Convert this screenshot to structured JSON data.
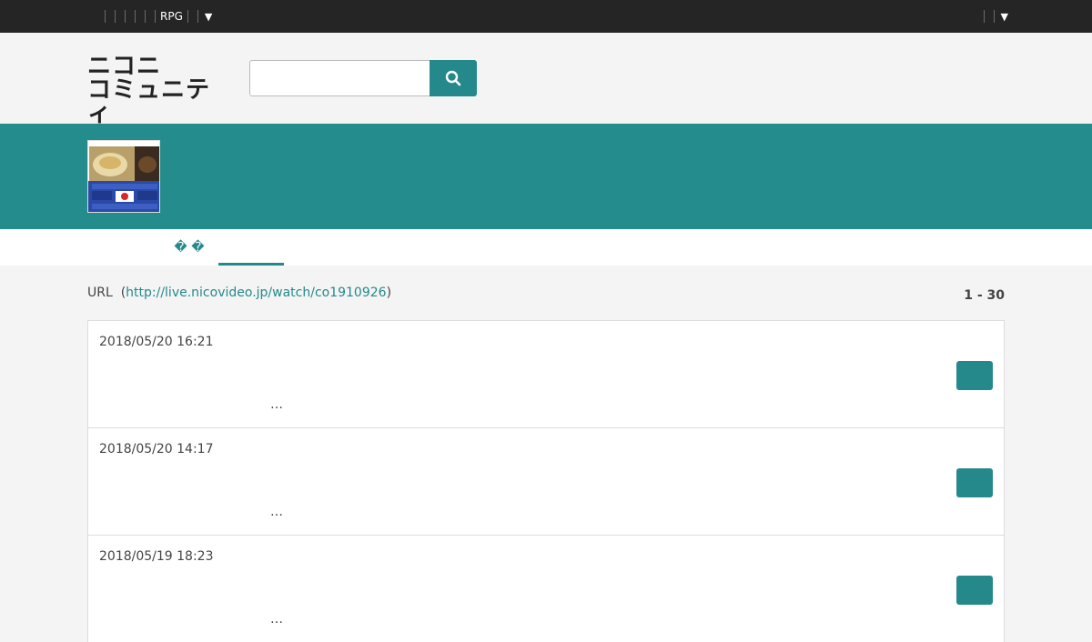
{
  "topbar": {
    "left_link": "RPG",
    "left_caret": "▼",
    "right_caret": "▼"
  },
  "header": {
    "logo_line1": "ニコニ",
    "logo_line2": "コミュニティ",
    "search_placeholder": ""
  },
  "tabs": [
    {
      "label": "� �"
    },
    {
      "label": ""
    }
  ],
  "content": {
    "url_prefix": "URL",
    "url_open": "(",
    "url": "http://live.nicovideo.jp/watch/co1910926",
    "url_close": ")",
    "count": "1 - 30"
  },
  "items": [
    {
      "date": "2018/05/20 16:21",
      "snippet": "…"
    },
    {
      "date": "2018/05/20 14:17",
      "snippet": "…"
    },
    {
      "date": "2018/05/19 18:23",
      "snippet": "…"
    }
  ],
  "colors": {
    "accent": "#25898b",
    "topbar": "#252525",
    "banner": "#258c8d"
  }
}
